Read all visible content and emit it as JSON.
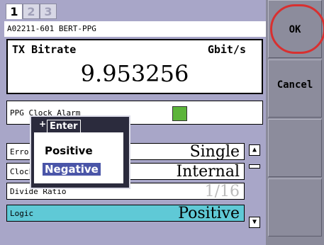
{
  "tabs": [
    {
      "label": "1",
      "active": true
    },
    {
      "label": "2",
      "active": false
    },
    {
      "label": "3",
      "active": false
    }
  ],
  "device": "A02211-601 BERT-PPG",
  "tx": {
    "label": "TX Bitrate",
    "unit": "Gbit/s",
    "value": "9.953256"
  },
  "alarm": {
    "label": "PPG Clock Alarm",
    "led_color": "#5cb43a"
  },
  "rows": [
    {
      "label": "Error Insertion",
      "value": "Single"
    },
    {
      "label": "Clock Source",
      "value": "Internal"
    },
    {
      "label": "Divide Ratio",
      "value": "1/16"
    },
    {
      "label": "Logic",
      "value": "Positive"
    }
  ],
  "popup": {
    "title": "Enter",
    "options": [
      "Positive",
      "Negative"
    ],
    "selected": "Negative"
  },
  "softkeys": {
    "ok": "OK",
    "cancel": "Cancel"
  },
  "colors": {
    "selected_row": "#5fc9d6",
    "alert_ring": "#d83030"
  }
}
